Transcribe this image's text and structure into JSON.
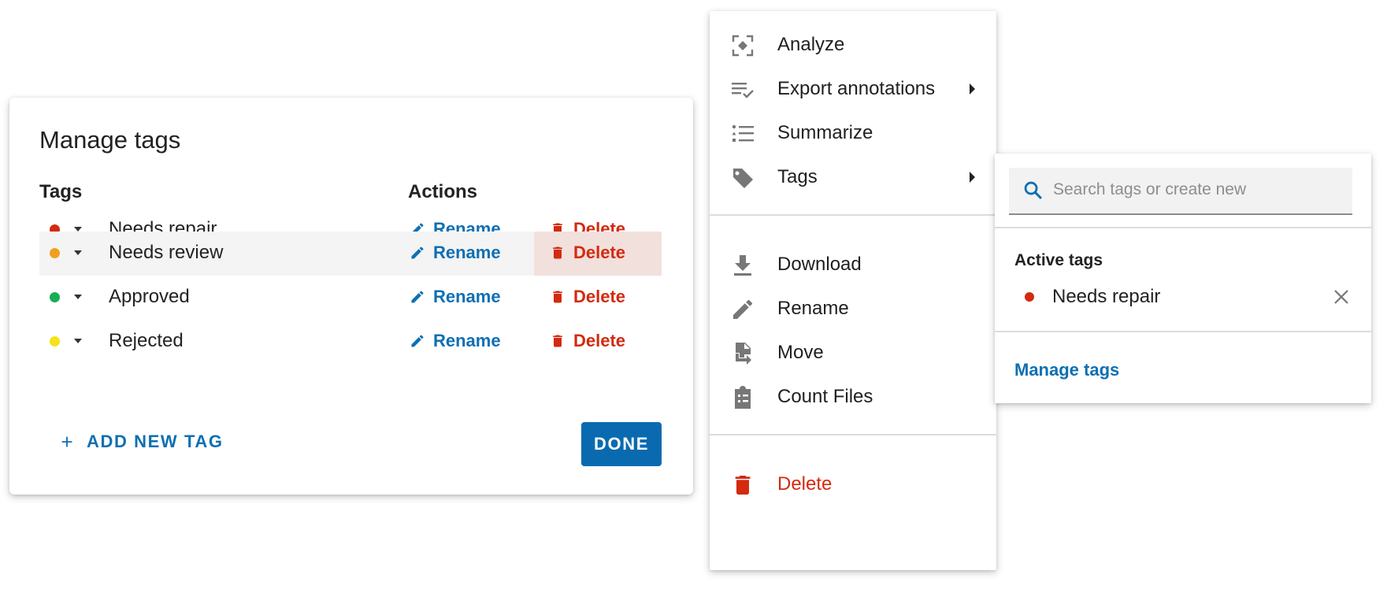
{
  "dialog": {
    "title": "Manage tags",
    "col_tags": "Tags",
    "col_actions": "Actions",
    "tags": [
      {
        "name": "Needs repair",
        "color": "#d32a10",
        "rename": "Rename",
        "delete": "Delete"
      },
      {
        "name": "Needs review",
        "color": "#f0a020",
        "rename": "Rename",
        "delete": "Delete"
      },
      {
        "name": "Approved",
        "color": "#1aac57",
        "rename": "Rename",
        "delete": "Delete"
      },
      {
        "name": "Rejected",
        "color": "#f5e21a",
        "rename": "Rename",
        "delete": "Delete"
      }
    ],
    "add_label": "ADD NEW TAG",
    "done_label": "DONE"
  },
  "menu": {
    "items": [
      {
        "label": "Analyze",
        "icon": "analyze-icon"
      },
      {
        "label": "Export annotations",
        "icon": "export-annotations-icon",
        "submenu": true
      },
      {
        "label": "Summarize",
        "icon": "summarize-icon"
      },
      {
        "label": "Tags",
        "icon": "tag-icon",
        "submenu": true
      },
      {
        "label": "Download",
        "icon": "download-icon"
      },
      {
        "label": "Rename",
        "icon": "pencil-icon"
      },
      {
        "label": "Move",
        "icon": "move-file-icon"
      },
      {
        "label": "Count Files",
        "icon": "clipboard-list-icon"
      },
      {
        "label": "Delete",
        "icon": "trash-icon",
        "danger": true
      }
    ]
  },
  "submenu": {
    "search_placeholder": "Search tags or create new",
    "active_heading": "Active tags",
    "active_tags": [
      {
        "name": "Needs repair",
        "color": "#d32a10"
      }
    ],
    "manage_link": "Manage tags"
  },
  "colors": {
    "accent": "#0e6fb3",
    "primary_button": "#0a6ab0",
    "danger": "#d32a10",
    "highlight_row": "#f4f4f4",
    "delete_hover": "#f2e0dc",
    "icon_gray": "#757575"
  }
}
